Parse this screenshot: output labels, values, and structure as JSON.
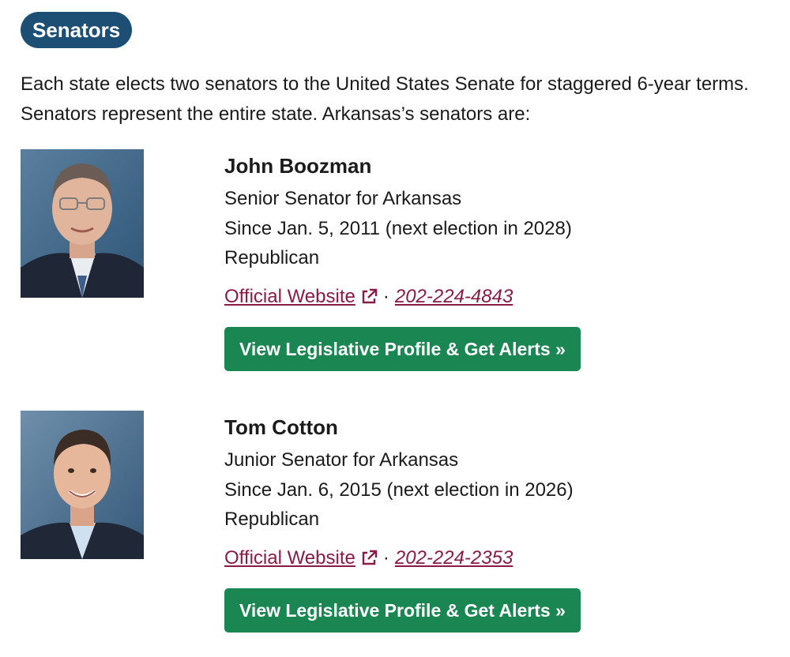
{
  "section": {
    "title": "Senators"
  },
  "intro": "Each state elects two senators to the United States Senate for staggered 6-year terms. Senators represent the entire state. Arkansas’s senators are:",
  "senators": [
    {
      "name": "John Boozman",
      "title": "Senior Senator for Arkansas",
      "since": "Since Jan. 5, 2011 (next election in 2028)",
      "party": "Republican",
      "website_label": "Official Website",
      "separator": "·",
      "phone": "202-224-4843",
      "cta_label": "View Legislative Profile & Get Alerts »"
    },
    {
      "name": "Tom Cotton",
      "title": "Junior Senator for Arkansas",
      "since": "Since Jan. 6, 2015 (next election in 2026)",
      "party": "Republican",
      "website_label": "Official Website",
      "separator": "·",
      "phone": "202-224-2353",
      "cta_label": "View Legislative Profile & Get Alerts »"
    }
  ],
  "colors": {
    "badge_bg": "#1d4f74",
    "link": "#8a1b46",
    "cta_bg": "#1a8752",
    "text": "#1b1b1b"
  },
  "icons": {
    "external_link": "external-link-icon"
  }
}
